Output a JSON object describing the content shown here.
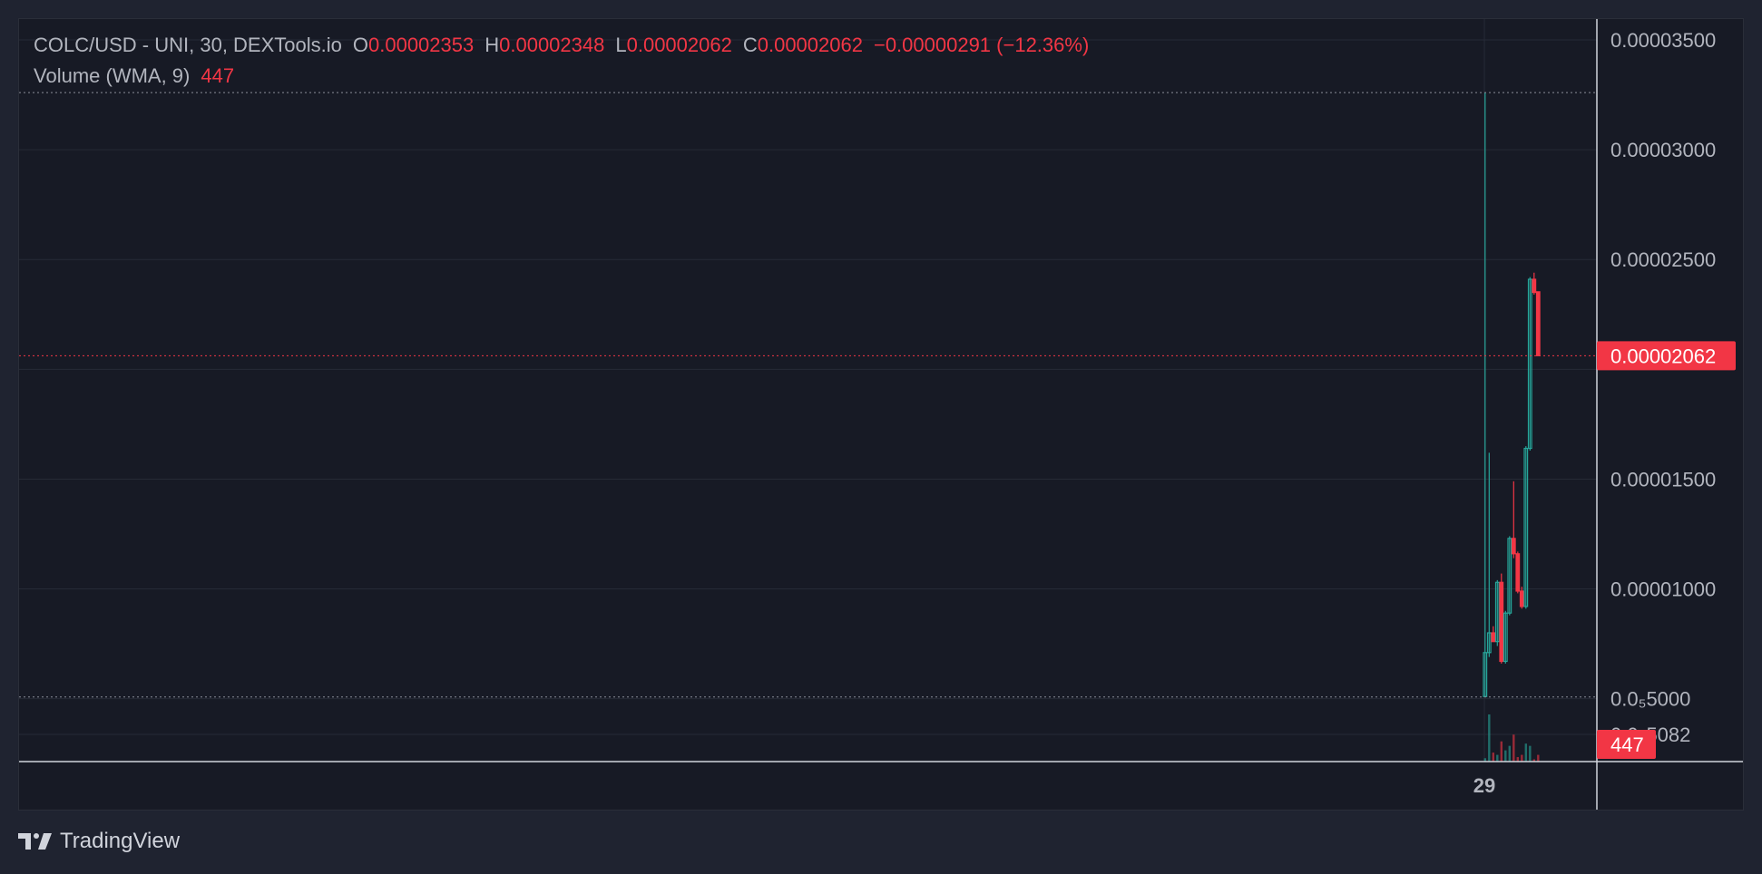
{
  "legend": {
    "symbol": "COLC/USD - UNI, 30, DEXTools.io",
    "o_label": "O",
    "o_value": "0.00002353",
    "h_label": "H",
    "h_value": "0.00002348",
    "l_label": "L",
    "l_value": "0.00002062",
    "c_label": "C",
    "c_value": "0.00002062",
    "change": "−0.00000291 (−12.36%)",
    "volume_label": "Volume (WMA, 9)",
    "volume_value": "447"
  },
  "price_axis_labels": [
    "0.00003500",
    "0.00003000",
    "0.00002500",
    "0.00001500",
    "0.00001000",
    "0.0₅5000",
    "0.0₅5082"
  ],
  "current_price_badge": "0.00002062",
  "volume_badge": "447",
  "x_axis_labels": [
    "29"
  ],
  "brand": "TradingView",
  "colors": {
    "up": "#26a69a",
    "down": "#f23645",
    "grid": "#262a36",
    "axis_text": "#b2b5be"
  },
  "chart_data": {
    "type": "candlestick",
    "title": "COLC/USD - UNI, 30, DEXTools.io",
    "ylim": [
      3.5e-06,
      3.5e-05
    ],
    "y_ticks": [
      5e-06,
      1e-05,
      1.5e-05,
      2e-05,
      2.5e-05,
      3e-05,
      3.5e-05
    ],
    "current_price": 2.062e-05,
    "dotted_levels": [
      3.26e-05,
      5.08e-06
    ],
    "candles": [
      {
        "o": 5.1e-06,
        "h": 3.26e-05,
        "l": 5.1e-06,
        "c": 7.1e-06
      },
      {
        "o": 7.1e-06,
        "h": 1.62e-05,
        "l": 6.9e-06,
        "c": 8e-06
      },
      {
        "o": 8e-06,
        "h": 8.3e-06,
        "l": 7.6e-06,
        "c": 7.6e-06
      },
      {
        "o": 7.6e-06,
        "h": 1.04e-05,
        "l": 7.4e-06,
        "c": 1.03e-05
      },
      {
        "o": 1.03e-05,
        "h": 1.07e-05,
        "l": 6.6e-06,
        "c": 6.7e-06
      },
      {
        "o": 6.7e-06,
        "h": 9e-06,
        "l": 6.6e-06,
        "c": 8.9e-06
      },
      {
        "o": 8.9e-06,
        "h": 1.24e-05,
        "l": 8.8e-06,
        "c": 1.23e-05
      },
      {
        "o": 1.23e-05,
        "h": 1.49e-05,
        "l": 1.14e-05,
        "c": 1.16e-05
      },
      {
        "o": 1.16e-05,
        "h": 1.17e-05,
        "l": 9.8e-06,
        "c": 9.9e-06
      },
      {
        "o": 9.9e-06,
        "h": 1.01e-05,
        "l": 9.1e-06,
        "c": 9.2e-06
      },
      {
        "o": 9.2e-06,
        "h": 1.65e-05,
        "l": 9.1e-06,
        "c": 1.64e-05
      },
      {
        "o": 1.64e-05,
        "h": 2.42e-05,
        "l": 1.63e-05,
        "c": 2.41e-05
      },
      {
        "o": 2.41e-05,
        "h": 2.44e-05,
        "l": 2.34e-05,
        "c": 2.35e-05
      },
      {
        "o": 2.353e-05,
        "h": 2.348e-05,
        "l": 2.062e-05,
        "c": 2.062e-05
      }
    ],
    "volume": [
      3,
      42,
      8,
      6,
      18,
      10,
      14,
      24,
      4,
      6,
      16,
      14,
      2,
      6
    ]
  }
}
